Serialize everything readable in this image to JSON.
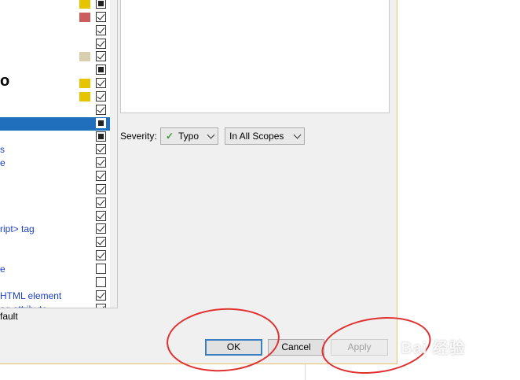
{
  "tree": {
    "rows": [
      {
        "label": "",
        "swatch": "#e7c400",
        "check": "partial",
        "selected": false
      },
      {
        "label": "",
        "swatch": "#cd5c5c",
        "check": "checked",
        "selected": false
      },
      {
        "label": "",
        "swatch": "",
        "check": "checked",
        "selected": false
      },
      {
        "label": "",
        "swatch": "",
        "check": "checked",
        "selected": false
      },
      {
        "label": "",
        "swatch": "#d8cfb0",
        "check": "checked",
        "selected": false
      },
      {
        "label": "",
        "swatch": "",
        "check": "partial",
        "selected": false
      },
      {
        "label": "o",
        "swatch": "#e7c400",
        "check": "checked",
        "selected": false,
        "big": true
      },
      {
        "label": "",
        "swatch": "#e7c400",
        "check": "checked",
        "selected": false
      },
      {
        "label": "",
        "swatch": "",
        "check": "checked",
        "selected": false
      },
      {
        "label": "",
        "swatch": "",
        "check": "partial",
        "selected": true
      },
      {
        "label": "",
        "swatch": "",
        "check": "partial",
        "selected": false
      },
      {
        "label": "s",
        "swatch": "",
        "check": "checked",
        "selected": false
      },
      {
        "label": "e",
        "swatch": "",
        "check": "checked",
        "selected": false
      },
      {
        "label": "",
        "swatch": "",
        "check": "checked",
        "selected": false
      },
      {
        "label": "",
        "swatch": "",
        "check": "checked",
        "selected": false
      },
      {
        "label": "",
        "swatch": "",
        "check": "checked",
        "selected": false
      },
      {
        "label": "",
        "swatch": "",
        "check": "checked",
        "selected": false
      },
      {
        "label": "ript> tag",
        "swatch": "",
        "check": "checked",
        "selected": false
      },
      {
        "label": "",
        "swatch": "",
        "check": "checked",
        "selected": false
      },
      {
        "label": "",
        "swatch": "",
        "check": "checked",
        "selected": false
      },
      {
        "label": "e",
        "swatch": "",
        "check": "unchecked",
        "selected": false
      },
      {
        "label": "",
        "swatch": "",
        "check": "unchecked",
        "selected": false
      },
      {
        "label": " HTML element",
        "swatch": "",
        "check": "checked",
        "selected": false
      },
      {
        "label": "ag attribute",
        "swatch": "",
        "check": "checked",
        "selected": false
      }
    ]
  },
  "reset_text": "fault",
  "severity": {
    "label": "Severity:",
    "value": "Typo",
    "scope": "In All Scopes"
  },
  "buttons": {
    "ok": "OK",
    "cancel": "Cancel",
    "apply": "Apply"
  },
  "watermark": "Bai 经验"
}
